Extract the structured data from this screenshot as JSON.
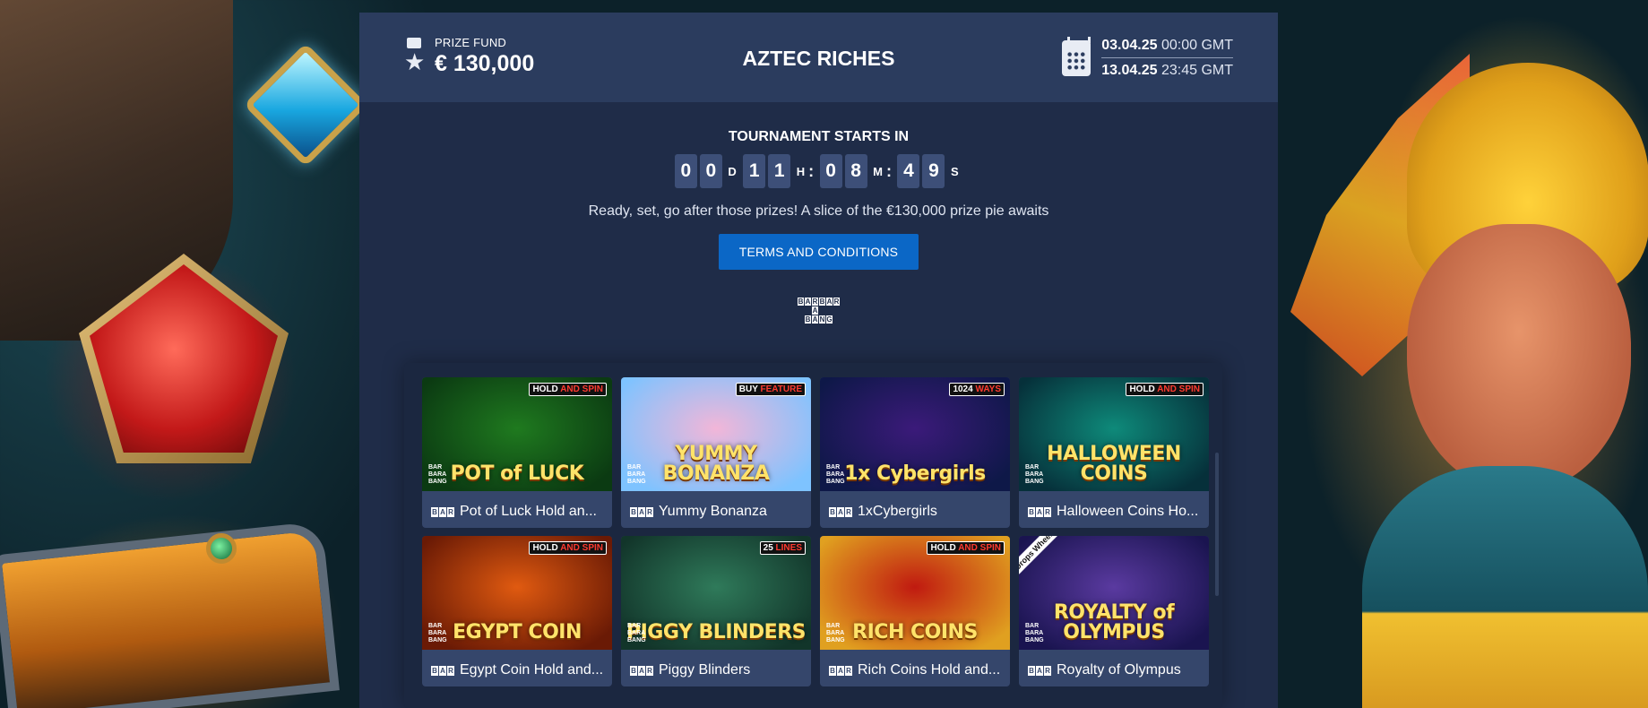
{
  "header": {
    "prize_label": "PRIZE FUND",
    "prize_value": "€ 130,000",
    "title": "AZTEC RICHES",
    "start_date": "03.04.25",
    "start_time": "00:00 GMT",
    "end_date": "13.04.25",
    "end_time": "23:45 GMT"
  },
  "countdown": {
    "label": "TOURNAMENT STARTS IN",
    "days": [
      "0",
      "0"
    ],
    "days_unit": "D",
    "hours": [
      "1",
      "1"
    ],
    "hours_unit": "H",
    "minutes": [
      "0",
      "8"
    ],
    "minutes_unit": "M",
    "seconds": [
      "4",
      "9"
    ],
    "seconds_unit": "S",
    "separator": ":"
  },
  "tagline": "Ready, set, go after those prizes! A slice of the €130,000 prize pie awaits",
  "terms_button": "TERMS AND CONDITIONS",
  "provider": {
    "logo_letters": [
      "B",
      "A",
      "R",
      "B",
      "A",
      "R",
      "A",
      "B",
      "A",
      "N",
      "G"
    ]
  },
  "games": [
    {
      "name": "Pot of Luck Hold an...",
      "badge_main": "HOLD ",
      "badge_accent": "AND SPIN",
      "logo": "POT of LUCK",
      "bg": "#1f7a1f",
      "bg2": "#0b3a12"
    },
    {
      "name": "Yummy Bonanza",
      "badge_main": "BUY ",
      "badge_accent": "FEATURE",
      "logo": "YUMMY BONANZA",
      "bg": "#f2b6d8",
      "bg2": "#7ec3ff"
    },
    {
      "name": "1xCybergirls",
      "badge_main": "1024 ",
      "badge_accent": "WAYS",
      "logo": "1x Cybergirls",
      "bg": "#3b1a7a",
      "bg2": "#0e1848"
    },
    {
      "name": "Halloween Coins Ho...",
      "badge_main": "HOLD ",
      "badge_accent": "AND SPIN",
      "logo": "HALLOWEEN COINS",
      "bg": "#0e8a7a",
      "bg2": "#06303a"
    },
    {
      "name": "Egypt Coin Hold and...",
      "badge_main": "HOLD ",
      "badge_accent": "AND SPIN",
      "logo": "EGYPT COIN",
      "bg": "#e05a10",
      "bg2": "#6a1a05"
    },
    {
      "name": "Piggy Blinders",
      "badge_main": "25 ",
      "badge_accent": "LINES",
      "logo": "PIGGY BLINDERS",
      "bg": "#2f7a5a",
      "bg2": "#12352a"
    },
    {
      "name": "Rich Coins Hold and...",
      "badge_main": "HOLD ",
      "badge_accent": "AND SPIN",
      "logo": "RICH COINS",
      "bg": "#c01a10",
      "bg2": "#e0a020"
    },
    {
      "name": "Royalty of Olympus",
      "badge_main": "",
      "badge_accent": "",
      "logo": "ROYALTY of OLYMPUS",
      "bg": "#5a3aa0",
      "bg2": "#1a1450",
      "ribbon": "Drops Wheels"
    }
  ],
  "game_mini_logo": "BAR BARA BANG",
  "bar_icon_letters": [
    "B",
    "A",
    "R"
  ],
  "colors": {
    "panel": "#1f2c48",
    "header": "#2b3c5e",
    "button": "#0b67c6",
    "digit_bg": "#3d4f78",
    "card": "#35466b"
  }
}
